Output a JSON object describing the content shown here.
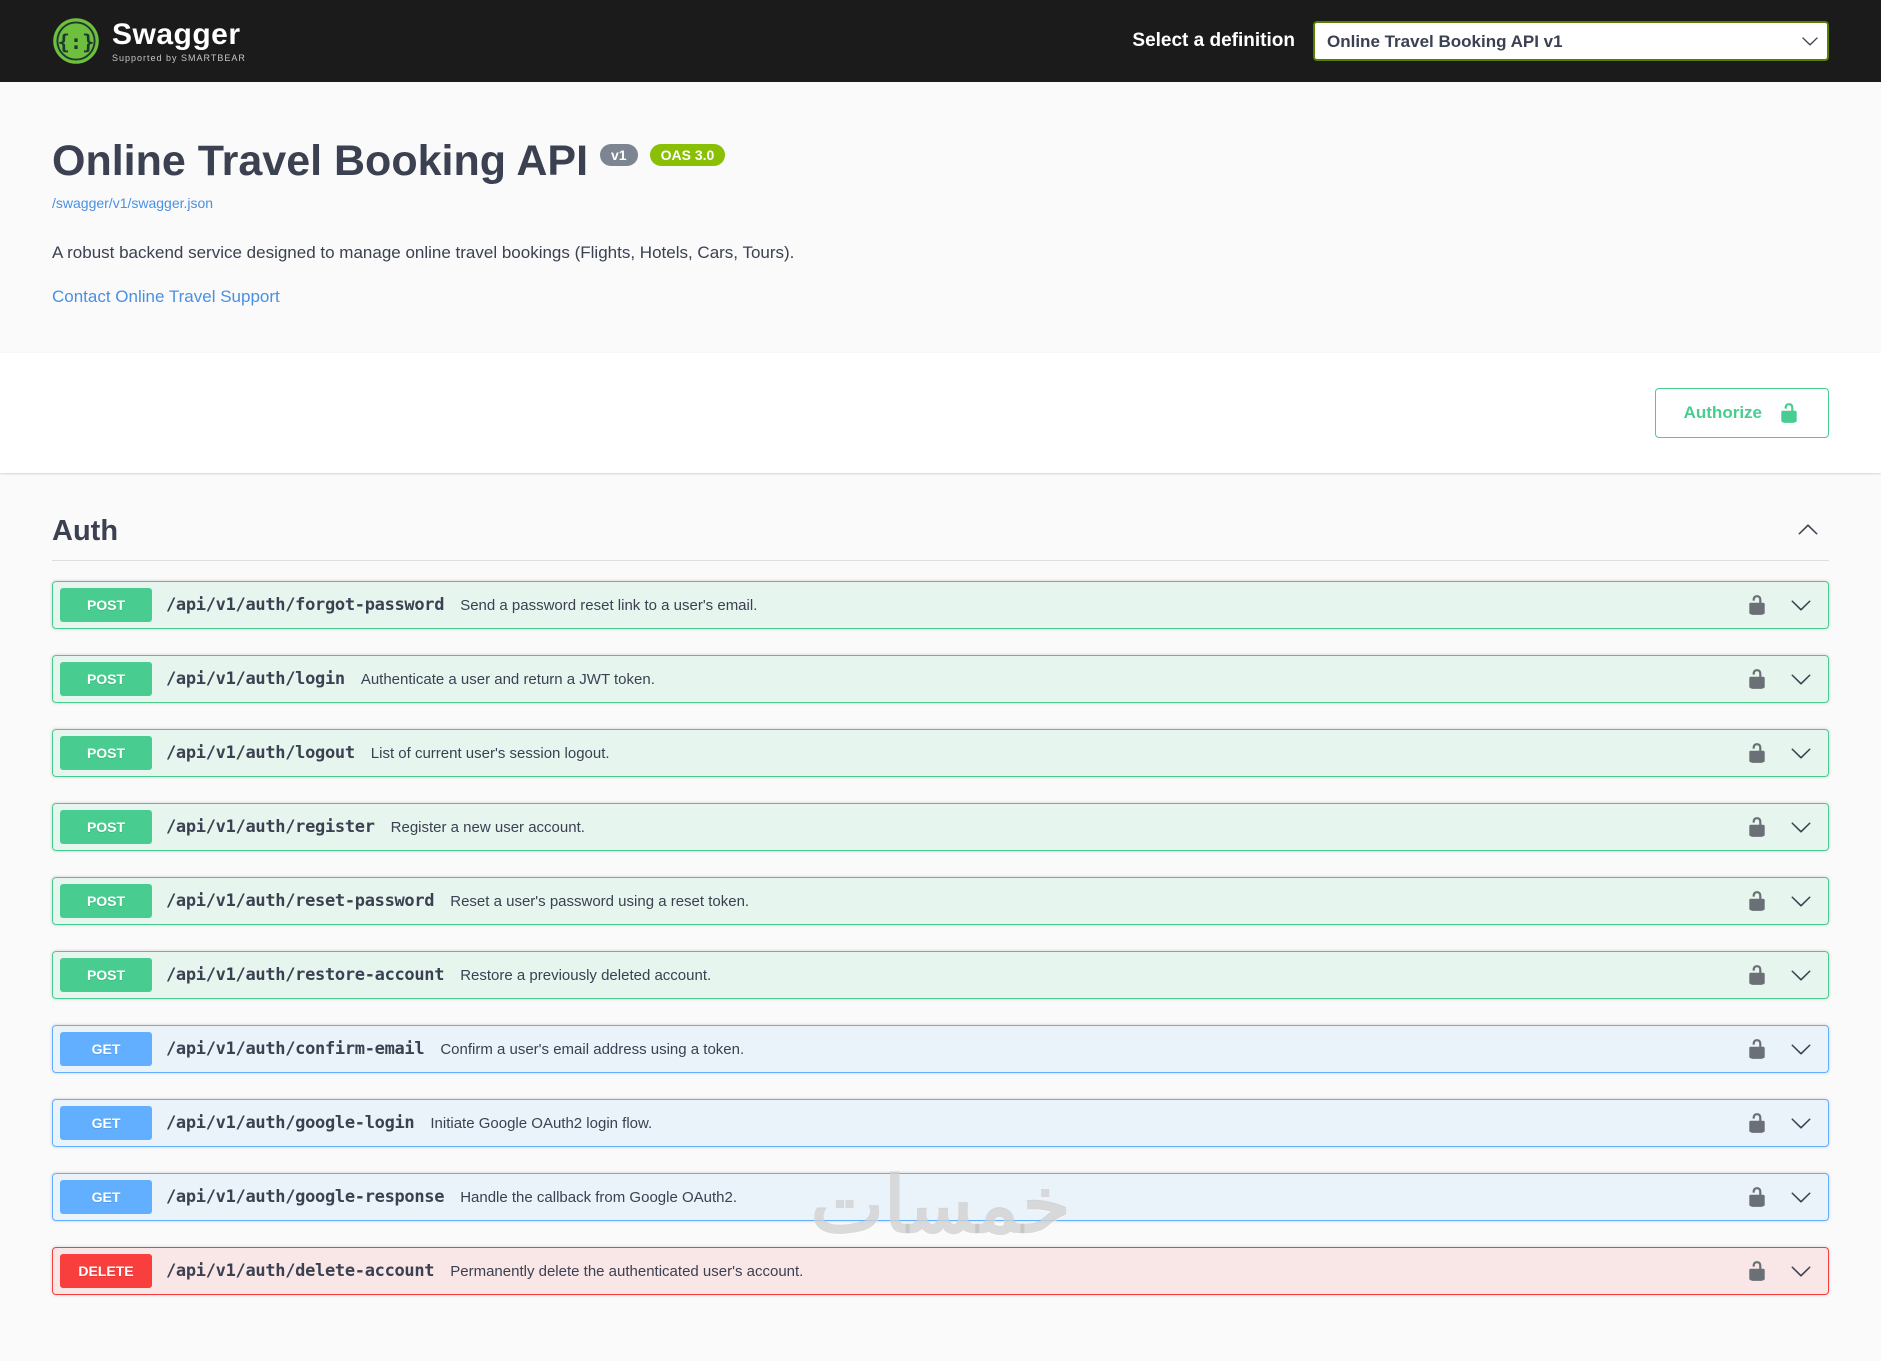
{
  "topbar": {
    "logo_text": "Swagger",
    "logo_subtext": "Supported by SMARTBEAR",
    "select_label": "Select a definition",
    "selected_definition": "Online Travel Booking API v1"
  },
  "info": {
    "title": "Online Travel Booking API",
    "version_badge": "v1",
    "oas_badge": "OAS 3.0",
    "spec_link": "/swagger/v1/swagger.json",
    "description": "A robust backend service designed to manage online travel bookings (Flights, Hotels, Cars, Tours).",
    "contact_link": "Contact Online Travel Support"
  },
  "scheme": {
    "authorize_label": "Authorize"
  },
  "section": {
    "tag": "Auth",
    "operations": [
      {
        "method": "POST",
        "path": "/api/v1/auth/forgot-password",
        "summary": "Send a password reset link to a user's email."
      },
      {
        "method": "POST",
        "path": "/api/v1/auth/login",
        "summary": "Authenticate a user and return a JWT token."
      },
      {
        "method": "POST",
        "path": "/api/v1/auth/logout",
        "summary": "List of current user's session logout."
      },
      {
        "method": "POST",
        "path": "/api/v1/auth/register",
        "summary": "Register a new user account."
      },
      {
        "method": "POST",
        "path": "/api/v1/auth/reset-password",
        "summary": "Reset a user's password using a reset token."
      },
      {
        "method": "POST",
        "path": "/api/v1/auth/restore-account",
        "summary": "Restore a previously deleted account."
      },
      {
        "method": "GET",
        "path": "/api/v1/auth/confirm-email",
        "summary": "Confirm a user's email address using a token."
      },
      {
        "method": "GET",
        "path": "/api/v1/auth/google-login",
        "summary": "Initiate Google OAuth2 login flow."
      },
      {
        "method": "GET",
        "path": "/api/v1/auth/google-response",
        "summary": "Handle the callback from Google OAuth2."
      },
      {
        "method": "DELETE",
        "path": "/api/v1/auth/delete-account",
        "summary": "Permanently delete the authenticated user's account."
      }
    ]
  },
  "watermark": "خمسات",
  "colors": {
    "topbar_bg": "#1b1b1b",
    "post": "#49cc90",
    "get": "#61affe",
    "delete": "#f93e3e",
    "oas_badge": "#89bf04",
    "version_badge": "#7d8492",
    "link": "#4990e2",
    "text": "#3b4151"
  }
}
